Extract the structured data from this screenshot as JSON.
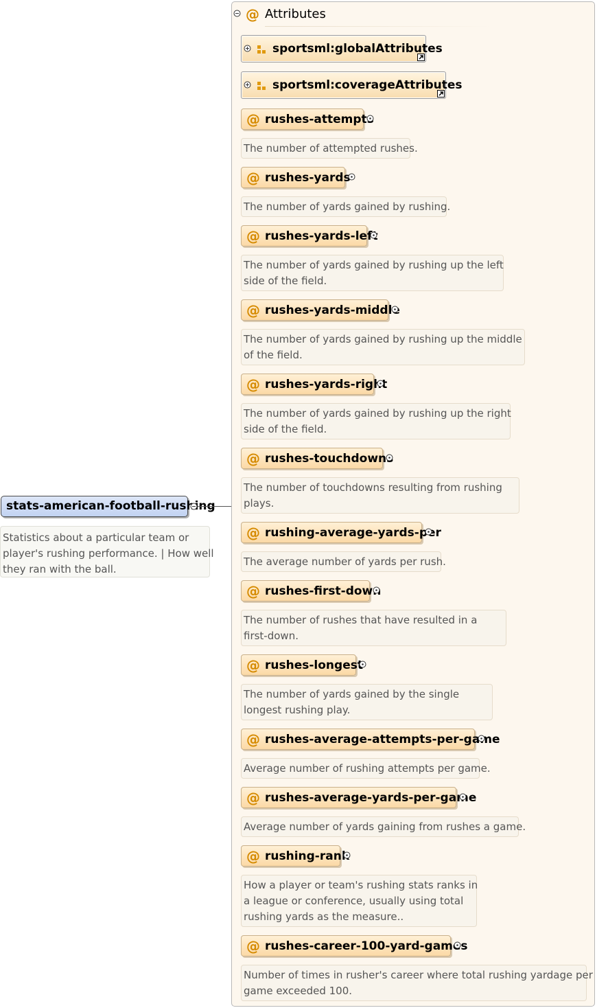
{
  "root": {
    "name": "stats-american-football-rushing",
    "doc_lines": [
      "Statistics about a particular team or",
      "player's rushing performance. | How well",
      "they ran with the ball."
    ]
  },
  "attributes_panel": {
    "title": "Attributes",
    "groups": [
      {
        "label": "sportsml:globalAttributes"
      },
      {
        "label": "sportsml:coverageAttributes"
      }
    ],
    "items": [
      {
        "name": "rushes-attempts",
        "doc_lines": [
          "The number of attempted rushes."
        ]
      },
      {
        "name": "rushes-yards",
        "doc_lines": [
          "The number of yards gained by rushing."
        ]
      },
      {
        "name": "rushes-yards-left",
        "doc_lines": [
          "The number of yards gained by rushing up the left",
          "side of the field."
        ]
      },
      {
        "name": "rushes-yards-middle",
        "doc_lines": [
          "The number of yards gained by rushing up the middle",
          "of the field."
        ]
      },
      {
        "name": "rushes-yards-right",
        "doc_lines": [
          "The number of yards gained by rushing up the right",
          "side of the field."
        ]
      },
      {
        "name": "rushes-touchdowns",
        "doc_lines": [
          "The number of touchdowns resulting from rushing",
          "plays."
        ]
      },
      {
        "name": "rushing-average-yards-per",
        "doc_lines": [
          "The average number of yards per rush."
        ]
      },
      {
        "name": "rushes-first-down",
        "doc_lines": [
          "The number of rushes that have resulted in a",
          "first-down."
        ]
      },
      {
        "name": "rushes-longest",
        "doc_lines": [
          "The number of yards gained by the single",
          "longest rushing play."
        ]
      },
      {
        "name": "rushes-average-attempts-per-game",
        "doc_lines": [
          "Average number of rushing attempts per game."
        ]
      },
      {
        "name": "rushes-average-yards-per-game",
        "doc_lines": [
          "Average number of yards gaining from rushes a game."
        ]
      },
      {
        "name": "rushing-rank",
        "doc_lines": [
          "How a player or team's rushing stats ranks in",
          "a league or conference, usually using total",
          "rushing yards as the measure.."
        ]
      },
      {
        "name": "rushes-career-100-yard-games",
        "doc_lines": [
          "Number of times in rusher's career where total rushing yardage per",
          "game exceeded 100."
        ]
      }
    ]
  },
  "colors": {
    "attribute_icon": "#d58a00",
    "root_fill": "#c2d3f2",
    "attribute_fill": "#fbd9a6",
    "panel_fill": "#fdf7ee"
  },
  "icons": {
    "attribute": "@",
    "expand": "plus-circle-icon",
    "collapse": "minus-circle-icon",
    "group": "attribute-group-icon",
    "reference": "reference-arrow-icon"
  }
}
